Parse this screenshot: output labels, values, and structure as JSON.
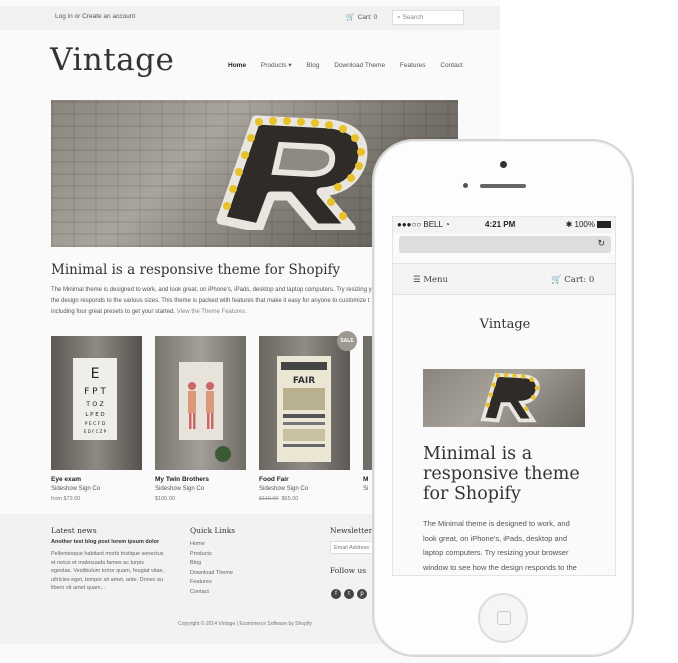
{
  "desktop": {
    "topbar": {
      "login_text": "Log in or Create an account",
      "cart_label": "Cart: 0",
      "search_placeholder": "Search"
    },
    "logo": "Vintage",
    "nav": [
      "Home",
      "Products ▾",
      "Blog",
      "Download Theme",
      "Features",
      "Contact"
    ],
    "tagline": "Minimal is a responsive theme for Shopify",
    "intro_text": "The Minimal theme is designed to work, and look great, on iPhone's, iPads, desktop and laptop computers. Try resizing your the design responds to the various sizes. This theme is packed with features that make it easy for anyone to customize t including four great presets to get your started.",
    "intro_link": "View the Theme Features.",
    "products": [
      {
        "name": "Eye exam",
        "vendor": "Sideshow Sign Co",
        "price_old": "",
        "price": "from $72.00"
      },
      {
        "name": "My Twin Brothers",
        "vendor": "Sideshow Sign Co",
        "price_old": "",
        "price": "$100.00"
      },
      {
        "name": "Food Fair",
        "vendor": "Sideshow Sign Co",
        "price_old": "$118.00",
        "price": "$65.00"
      },
      {
        "name": "M",
        "vendor": "Si",
        "price_old": "",
        "price": ""
      }
    ],
    "sale_badge": "SALE",
    "footer": {
      "latest_news_heading": "Latest news",
      "latest_post_title": "Another test blog post lorem ipsum dolor",
      "latest_post_body": "Pellentesque habitant morbi tristique senectus et netus et malesuada fames ac turpis egestas. Vestibulum tortor quam, feugiat vitae, ultricies eget, tempor sit amet, ante. Donec eu libero sit amet quam...",
      "quick_links_heading": "Quick Links",
      "quick_links": [
        "Home",
        "Products",
        "Blog",
        "Download Theme",
        "Features",
        "Contact"
      ],
      "newsletter_heading": "Newsletter",
      "newsletter_placeholder": "Email Address",
      "follow_heading": "Follow us",
      "copyright": "Copyright © 2014 Vintage | Ecommerce Software by Shopify"
    }
  },
  "phone": {
    "status": {
      "carrier": "●●●○○ BELL",
      "time": "4:21 PM",
      "battery": "100%"
    },
    "menu_label": "☰ Menu",
    "cart_label": "Cart: 0",
    "logo": "Vintage",
    "title": "Minimal is a responsive theme for Shopify",
    "body": "The Minimal theme is designed to work, and look great, on iPhone's, iPads, desktop and laptop computers. Try resizing your browser window to see how the design responds to the various sizes. This theme is packed with"
  },
  "colors": {
    "page_bg": "#fafafa",
    "footer_bg": "#f2f2f2",
    "bulb": "#e8c22a"
  },
  "icons": [
    "cart-icon",
    "search-icon",
    "facebook-icon",
    "twitter-icon",
    "pinterest-icon",
    "wifi-icon",
    "bluetooth-icon",
    "reload-icon",
    "menu-icon"
  ]
}
